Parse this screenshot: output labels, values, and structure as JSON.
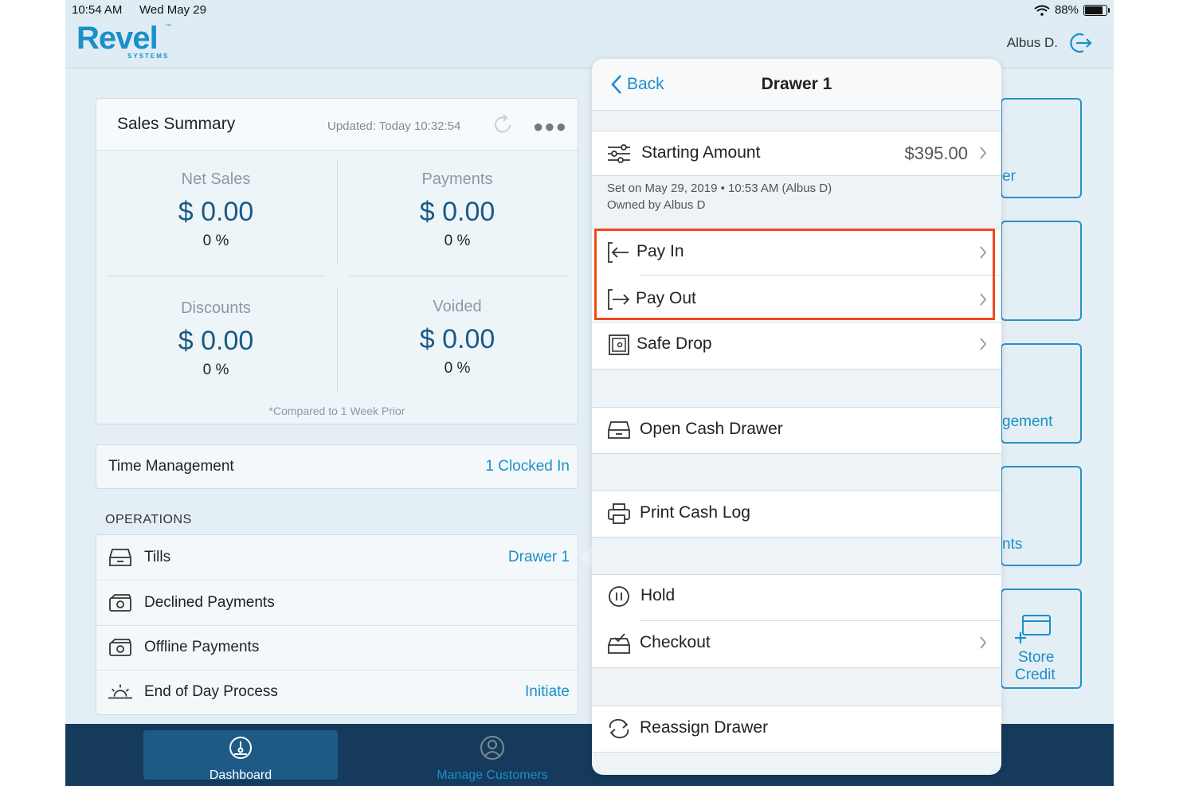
{
  "status_bar": {
    "time": "10:54 AM",
    "date": "Wed May 29",
    "battery": "88%"
  },
  "header": {
    "logo": "Revel",
    "logo_sub": "SYSTEMS",
    "logo_tm": "™",
    "user": "Albus D."
  },
  "sales_summary": {
    "title": "Sales Summary",
    "updated": "Updated: Today 10:32:54",
    "metrics": [
      {
        "label": "Net Sales",
        "value": "$ 0.00",
        "pct": "0 %"
      },
      {
        "label": "Payments",
        "value": "$ 0.00",
        "pct": "0 %"
      },
      {
        "label": "Discounts",
        "value": "$ 0.00",
        "pct": "0 %"
      },
      {
        "label": "Voided",
        "value": "$ 0.00",
        "pct": "0 %"
      }
    ],
    "compare_note": "*Compared to 1 Week Prior"
  },
  "time_management": {
    "label": "Time Management",
    "value": "1 Clocked In"
  },
  "operations": {
    "label": "OPERATIONS",
    "items": [
      {
        "label": "Tills",
        "value": "Drawer 1"
      },
      {
        "label": "Declined Payments",
        "value": ""
      },
      {
        "label": "Offline Payments",
        "value": ""
      },
      {
        "label": "End of Day Process",
        "value": "Initiate"
      }
    ]
  },
  "right_tiles": [
    "er",
    "",
    "gement",
    "nts",
    "Store",
    "Credit"
  ],
  "tabs": {
    "dashboard": "Dashboard",
    "customers": "Manage Customers"
  },
  "popover": {
    "back": "Back",
    "title": "Drawer 1",
    "starting_amount": {
      "label": "Starting Amount",
      "value": "$395.00"
    },
    "set_on": "Set on May 29, 2019 • 10:53 AM (Albus D)",
    "owned_by": "Owned by Albus D",
    "pay_in": "Pay In",
    "pay_out": "Pay Out",
    "safe_drop": "Safe Drop",
    "open_cash_drawer": "Open Cash Drawer",
    "print_cash_log": "Print Cash Log",
    "hold": "Hold",
    "checkout": "Checkout",
    "reassign_drawer": "Reassign Drawer"
  },
  "colors": {
    "accent": "#1b8fc9",
    "highlight": "#f04a1c",
    "tabbar": "#153a5c"
  }
}
